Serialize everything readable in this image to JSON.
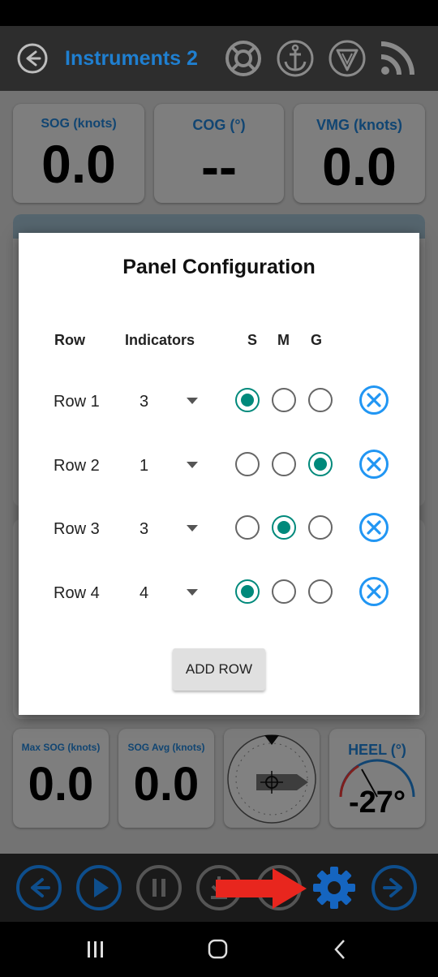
{
  "app": {
    "title": "Instruments 2"
  },
  "toolbar": {
    "icons": [
      "lifebuoy-icon",
      "anchor-icon",
      "compass-icon",
      "rss-icon"
    ]
  },
  "top_cards": [
    {
      "label": "SOG (knots)",
      "value": "0.0"
    },
    {
      "label": "COG (°)",
      "value": "--"
    },
    {
      "label": "VMG (knots)",
      "value": "0.0"
    }
  ],
  "bottom_cards": [
    {
      "label": "Max SOG (knots)",
      "value": "0.0"
    },
    {
      "label": "SOG Avg (knots)",
      "value": "0.0"
    },
    {
      "label": "HEEL (°)",
      "value": "-27°"
    }
  ],
  "dialog": {
    "title": "Panel Configuration",
    "headers": {
      "row": "Row",
      "indicators": "Indicators",
      "s": "S",
      "m": "M",
      "g": "G"
    },
    "rows": [
      {
        "label": "Row 1",
        "count": "3",
        "selected": "S"
      },
      {
        "label": "Row 2",
        "count": "1",
        "selected": "G"
      },
      {
        "label": "Row 3",
        "count": "3",
        "selected": "M"
      },
      {
        "label": "Row 4",
        "count": "4",
        "selected": "S"
      }
    ],
    "add_row_label": "ADD ROW"
  },
  "bottom_bar": {
    "icons": [
      "back-arrow-icon",
      "play-icon",
      "pause-icon",
      "download-icon",
      "record-icon",
      "gear-icon",
      "forward-arrow-icon"
    ]
  },
  "colors": {
    "accent_blue": "#1f7fd0",
    "radio_green": "#00897b",
    "arrow_red": "#e8261e"
  }
}
